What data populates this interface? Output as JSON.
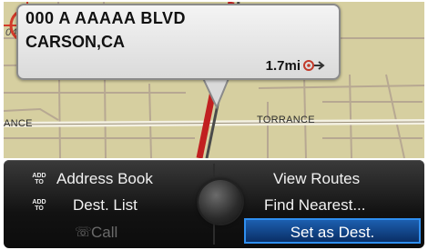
{
  "callout": {
    "address_line1": "000  A  AAAAA  BLVD",
    "address_line2": "CARSON,CA",
    "distance": "1.7mi"
  },
  "map": {
    "street_labels": [
      "ANCE",
      "TORRANCE"
    ],
    "corner_label": "04"
  },
  "menu": {
    "add_to_label": "ADD TO",
    "address_book": "Address Book",
    "dest_list": "Dest. List",
    "call": "Call",
    "view_routes": "View Routes",
    "find_nearest": "Find Nearest...",
    "set_as_dest": "Set as Dest."
  },
  "colors": {
    "map_background": "#d6cfa0",
    "menu_background": "#121212",
    "selection_blue": "#1c5fb0",
    "cursor_red": "#d23a2a"
  }
}
